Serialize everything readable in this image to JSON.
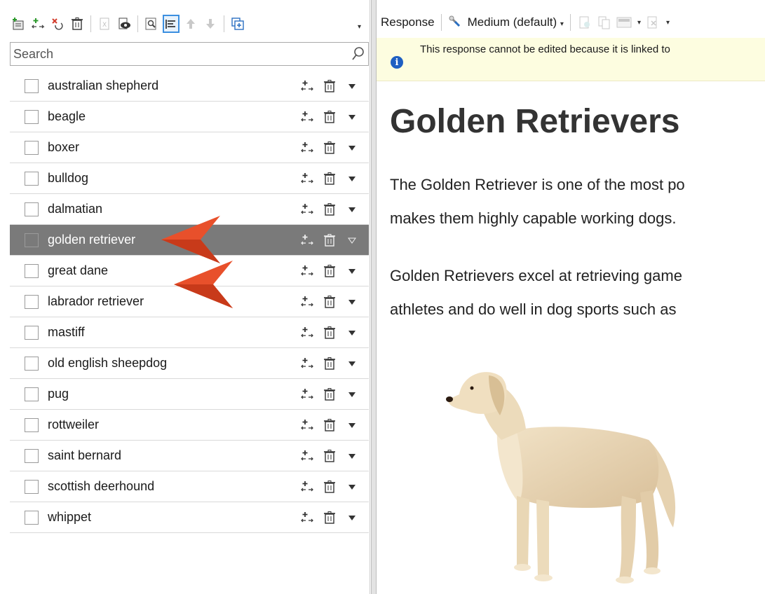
{
  "left_panel": {
    "search": {
      "placeholder": "Search",
      "value": ""
    },
    "toolbar": {
      "buttons": [
        "add-item-icon",
        "insert-item-icon",
        "remove-item-icon",
        "delete-icon",
        "export-icon",
        "preview-icon",
        "find-icon",
        "align-list-icon",
        "move-up-icon",
        "move-down-icon",
        "duplicate-icon"
      ]
    },
    "items": [
      {
        "label": "australian shepherd",
        "selected": false
      },
      {
        "label": "beagle",
        "selected": false
      },
      {
        "label": "boxer",
        "selected": false
      },
      {
        "label": "bulldog",
        "selected": false
      },
      {
        "label": "dalmatian",
        "selected": false
      },
      {
        "label": "golden retriever",
        "selected": true
      },
      {
        "label": "great dane",
        "selected": false
      },
      {
        "label": "labrador retriever",
        "selected": false
      },
      {
        "label": "mastiff",
        "selected": false
      },
      {
        "label": "old english sheepdog",
        "selected": false
      },
      {
        "label": "pug",
        "selected": false
      },
      {
        "label": "rottweiler",
        "selected": false
      },
      {
        "label": "saint bernard",
        "selected": false
      },
      {
        "label": "scottish deerhound",
        "selected": false
      },
      {
        "label": "whippet",
        "selected": false
      }
    ]
  },
  "right_panel": {
    "toolbar": {
      "response_label": "Response",
      "medium_label": "Medium (default)"
    },
    "info_message": "This response cannot be edited because it is linked to",
    "document": {
      "title": "Golden Retrievers",
      "paragraphs": [
        [
          "The Golden Retriever is one of the most po",
          "makes them highly capable working dogs."
        ],
        [
          "Golden Retrievers excel at retrieving game",
          "athletes and do well in dog sports such as"
        ]
      ]
    }
  },
  "colors": {
    "selected_row": "#7a7a7a",
    "callout_arrow": "#e8502b",
    "info_bar": "#fdfde0",
    "info_icon": "#1e5fc2",
    "active_button_border": "#3b8fe0"
  }
}
